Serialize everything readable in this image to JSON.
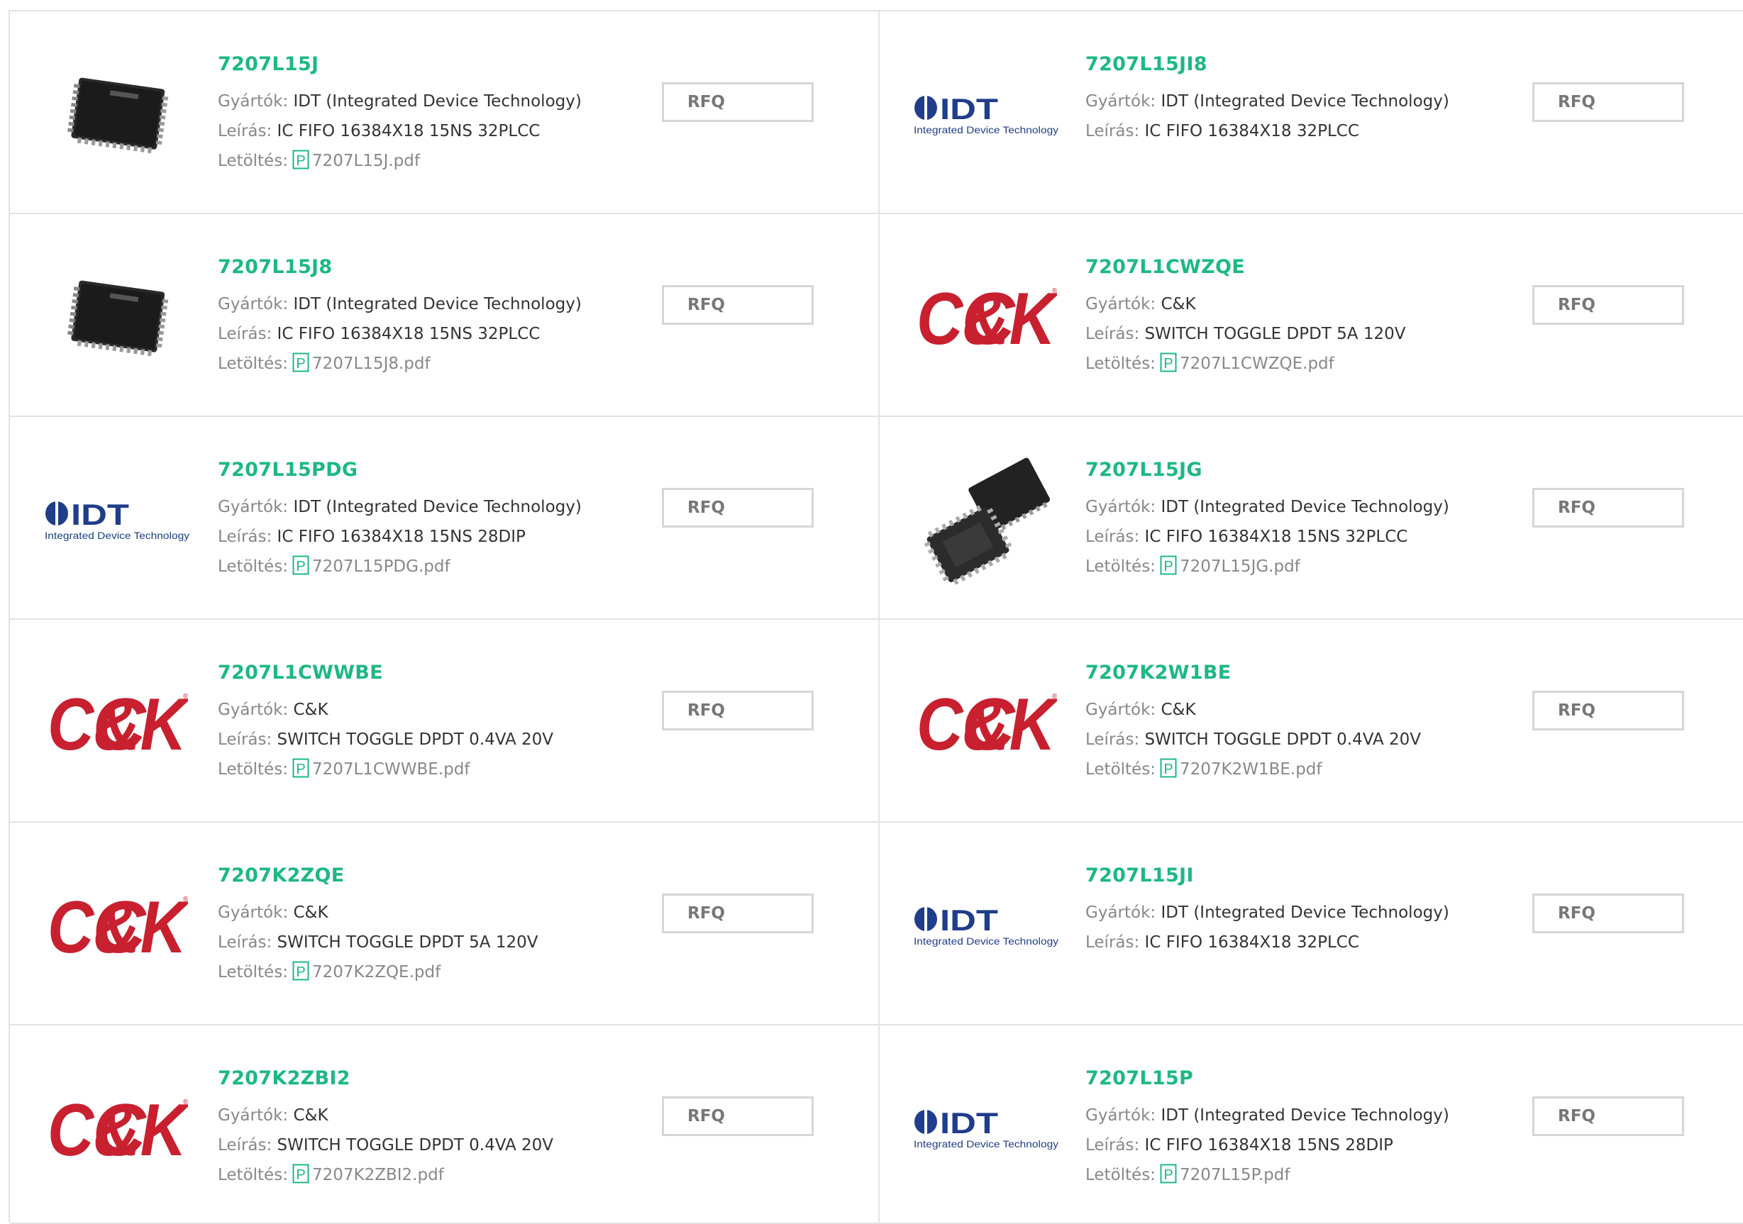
{
  "labels": {
    "manufacturer": "Gyártók:",
    "description": "Leírás:",
    "download": "Letöltés:",
    "rfq": "RFQ"
  },
  "colors": {
    "part_number": "#1db884",
    "ck_red": "#c8202f",
    "idt_blue": "#1f3d8a"
  },
  "products": [
    {
      "part": "7207L15J",
      "logo": "chip-plcc-photo",
      "manufacturer": "IDT (Integrated Device Technology)",
      "description": "IC FIFO 16384X18 15NS 32PLCC",
      "file": "7207L15J.pdf"
    },
    {
      "part": "7207L15JI8",
      "logo": "idt-logo",
      "manufacturer": "IDT (Integrated Device Technology)",
      "description": "IC FIFO 16384X18 32PLCC",
      "file": ""
    },
    {
      "part": "7207L15J8",
      "logo": "chip-plcc-photo",
      "manufacturer": "IDT (Integrated Device Technology)",
      "description": "IC FIFO 16384X18 15NS 32PLCC",
      "file": "7207L15J8.pdf"
    },
    {
      "part": "7207L1CWZQE",
      "logo": "ck-logo",
      "manufacturer": "C&K",
      "description": "SWITCH TOGGLE DPDT 5A 120V",
      "file": "7207L1CWZQE.pdf"
    },
    {
      "part": "7207L15PDG",
      "logo": "idt-logo",
      "manufacturer": "IDT (Integrated Device Technology)",
      "description": "IC FIFO 16384X18 15NS 28DIP",
      "file": "7207L15PDG.pdf"
    },
    {
      "part": "7207L15JG",
      "logo": "chip-pair-photo",
      "manufacturer": "IDT (Integrated Device Technology)",
      "description": "IC FIFO 16384X18 15NS 32PLCC",
      "file": "7207L15JG.pdf"
    },
    {
      "part": "7207L1CWWBE",
      "logo": "ck-logo",
      "manufacturer": "C&K",
      "description": "SWITCH TOGGLE DPDT 0.4VA 20V",
      "file": "7207L1CWWBE.pdf"
    },
    {
      "part": "7207K2W1BE",
      "logo": "ck-logo",
      "manufacturer": "C&K",
      "description": "SWITCH TOGGLE DPDT 0.4VA 20V",
      "file": "7207K2W1BE.pdf"
    },
    {
      "part": "7207K2ZQE",
      "logo": "ck-logo",
      "manufacturer": "C&K",
      "description": "SWITCH TOGGLE DPDT 5A 120V",
      "file": "7207K2ZQE.pdf"
    },
    {
      "part": "7207L15JI",
      "logo": "idt-logo",
      "manufacturer": "IDT (Integrated Device Technology)",
      "description": "IC FIFO 16384X18 32PLCC",
      "file": ""
    },
    {
      "part": "7207K2ZBI2",
      "logo": "ck-logo",
      "manufacturer": "C&K",
      "description": "SWITCH TOGGLE DPDT 0.4VA 20V",
      "file": "7207K2ZBI2.pdf"
    },
    {
      "part": "7207L15P",
      "logo": "idt-logo",
      "manufacturer": "IDT (Integrated Device Technology)",
      "description": "IC FIFO 16384X18 15NS 28DIP",
      "file": "7207L15P.pdf"
    }
  ]
}
